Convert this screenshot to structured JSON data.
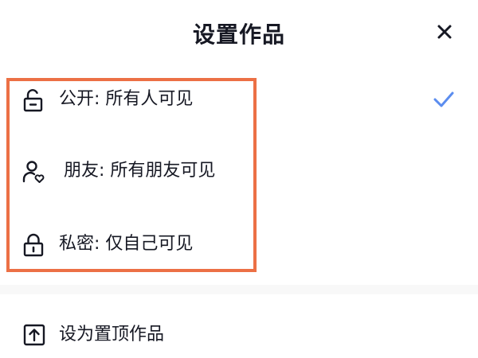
{
  "header": {
    "title": "设置作品",
    "close_icon": "close-icon"
  },
  "visibility_options": [
    {
      "label": "公开: 所有人可见",
      "icon": "unlock-icon",
      "selected": true
    },
    {
      "label": "朋友: 所有朋友可见",
      "icon": "user-heart-icon",
      "selected": false
    },
    {
      "label": "私密: 仅自己可见",
      "icon": "lock-icon",
      "selected": false
    }
  ],
  "pin_top": {
    "label": "设为置顶作品",
    "icon": "arrow-up-box-icon"
  },
  "colors": {
    "accent_check": "#5b8def",
    "highlight_border": "#ec7045",
    "text": "#161823",
    "divider": "#f8f8f8"
  }
}
